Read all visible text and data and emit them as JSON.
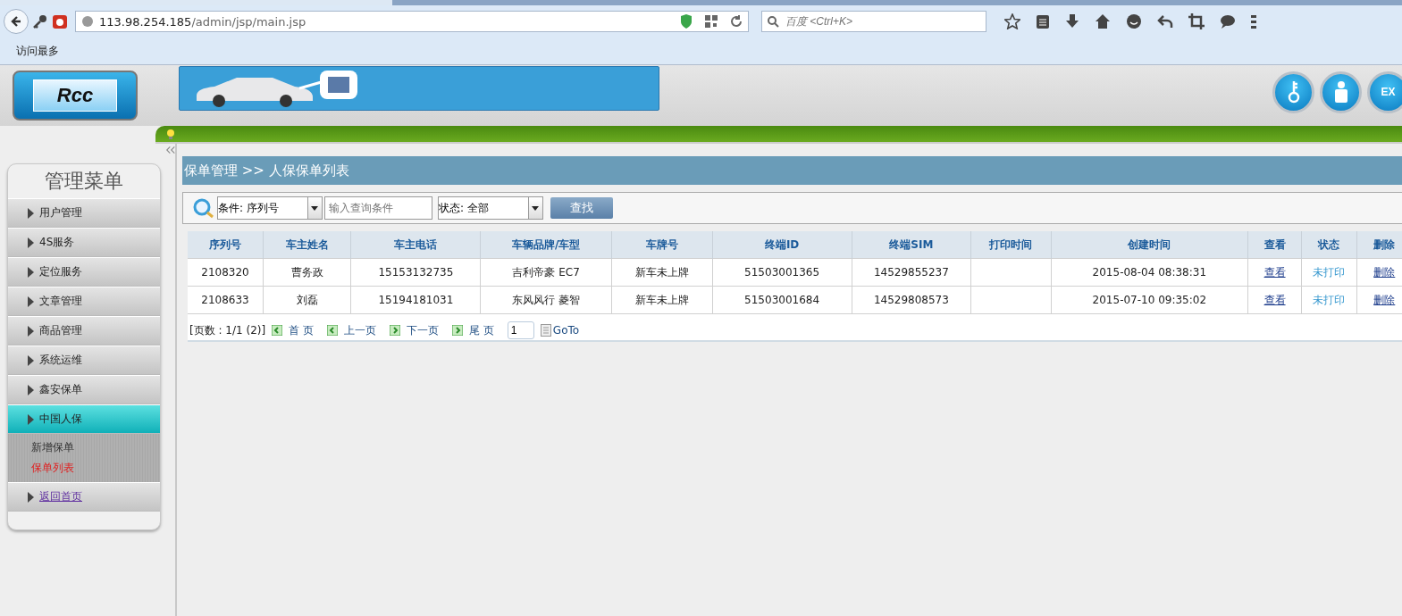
{
  "browser": {
    "url_host": "113.98.254.185",
    "url_path": "/admin/jsp/main.jsp",
    "search_placeholder": "百度 <Ctrl+K>",
    "bookmarks": [
      "访问最多"
    ]
  },
  "header": {
    "logo": "Rcc",
    "buttons": [
      {
        "kind": "key"
      },
      {
        "kind": "user"
      },
      {
        "kind": "exit",
        "label": "EX"
      }
    ]
  },
  "sidebar": {
    "title": "管理菜单",
    "items": [
      {
        "label": "用户管理",
        "kind": "menu",
        "selected": false
      },
      {
        "label": "4S服务",
        "kind": "menu",
        "selected": false
      },
      {
        "label": "定位服务",
        "kind": "menu",
        "selected": false
      },
      {
        "label": "文章管理",
        "kind": "menu",
        "selected": false
      },
      {
        "label": "商品管理",
        "kind": "menu",
        "selected": false
      },
      {
        "label": "系统运维",
        "kind": "menu",
        "selected": false
      },
      {
        "label": "鑫安保单",
        "kind": "menu",
        "selected": false
      },
      {
        "label": "中国人保",
        "kind": "menu",
        "selected": true,
        "children": [
          {
            "label": "新增保单",
            "selected": false
          },
          {
            "label": "保单列表",
            "selected": true
          }
        ]
      },
      {
        "label": "返回首页",
        "kind": "link",
        "selected": false
      }
    ]
  },
  "breadcrumb": "保单管理 >> 人保保单列表",
  "search": {
    "condition": "条件: 序列号",
    "placeholder": "输入查询条件",
    "status": "状态: 全部",
    "button": "查找"
  },
  "table": {
    "columns": [
      "序列号",
      "车主姓名",
      "车主电话",
      "车辆品牌/车型",
      "车牌号",
      "终端ID",
      "终端SIM",
      "打印时间",
      "创建时间",
      "查看",
      "状态",
      "删除"
    ],
    "rows": [
      {
        "serial": "2108320",
        "owner": "曹务政",
        "phone": "15153132735",
        "model": "吉利帝豪 EC7",
        "plate": "新车未上牌",
        "terminal_id": "51503001365",
        "sim": "14529855237",
        "created": "2015-08-04 08:38:31",
        "view": "查看",
        "status": "未打印",
        "delete": "删除"
      },
      {
        "serial": "2108633",
        "owner": "刘磊",
        "phone": "15194181031",
        "model": "东风风行 菱智",
        "plate": "新车未上牌",
        "terminal_id": "51503001684",
        "sim": "14529808573",
        "created": "2015-07-10 09:35:02",
        "view": "查看",
        "status": "未打印",
        "delete": "删除"
      }
    ]
  },
  "pager": {
    "info": "[页数 : 1/1 (2)]",
    "first": "首 页",
    "prev": "上一页",
    "next": "下一页",
    "last": "尾 页",
    "page": "1",
    "goto": "GoTo"
  }
}
